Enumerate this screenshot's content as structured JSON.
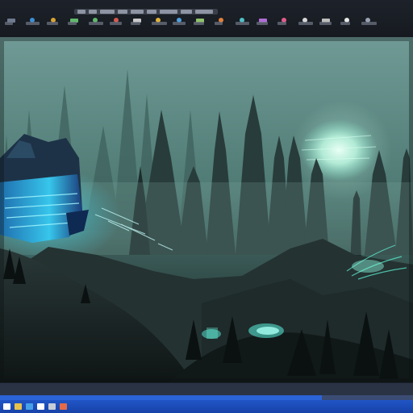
{
  "app": {
    "toolbar_icons": [
      {
        "name": "app-icon",
        "color": "#6f7a90"
      },
      {
        "name": "open-icon",
        "color": "#3c8fd6"
      },
      {
        "name": "save-icon",
        "color": "#d9a431"
      },
      {
        "name": "undo-icon",
        "color": "#5fb86b"
      },
      {
        "name": "redo-icon",
        "color": "#5fb86b"
      },
      {
        "name": "brush-icon",
        "color": "#d45a4e"
      },
      {
        "name": "eraser-icon",
        "color": "#c9c9c9"
      },
      {
        "name": "fill-icon",
        "color": "#e0b23a"
      },
      {
        "name": "select-icon",
        "color": "#4fa0e0"
      },
      {
        "name": "move-icon",
        "color": "#8fc36a"
      },
      {
        "name": "crop-icon",
        "color": "#e07f3a"
      },
      {
        "name": "layers-icon",
        "color": "#50c0c8"
      },
      {
        "name": "filter-icon",
        "color": "#b06cd6"
      },
      {
        "name": "color-icon",
        "color": "#e05c8a"
      },
      {
        "name": "zoom-icon",
        "color": "#d8d8d8"
      },
      {
        "name": "hand-icon",
        "color": "#bdbdbd"
      },
      {
        "name": "text-icon",
        "color": "#e8e8e8"
      },
      {
        "name": "settings-icon",
        "color": "#9aa3b4"
      }
    ],
    "taskbar_icons": [
      {
        "name": "start-icon",
        "color": "#ffffff"
      },
      {
        "name": "explorer-icon",
        "color": "#e8c24a"
      },
      {
        "name": "browser-icon",
        "color": "#45a0e8"
      },
      {
        "name": "editor-icon",
        "color": "#ffffff"
      },
      {
        "name": "terminal-icon",
        "color": "#c7ccd6"
      },
      {
        "name": "media-icon",
        "color": "#e46a4a"
      }
    ],
    "progress": 0.78,
    "colors": {
      "accent": "#2b63d9",
      "glow": "#38e0d8"
    }
  }
}
